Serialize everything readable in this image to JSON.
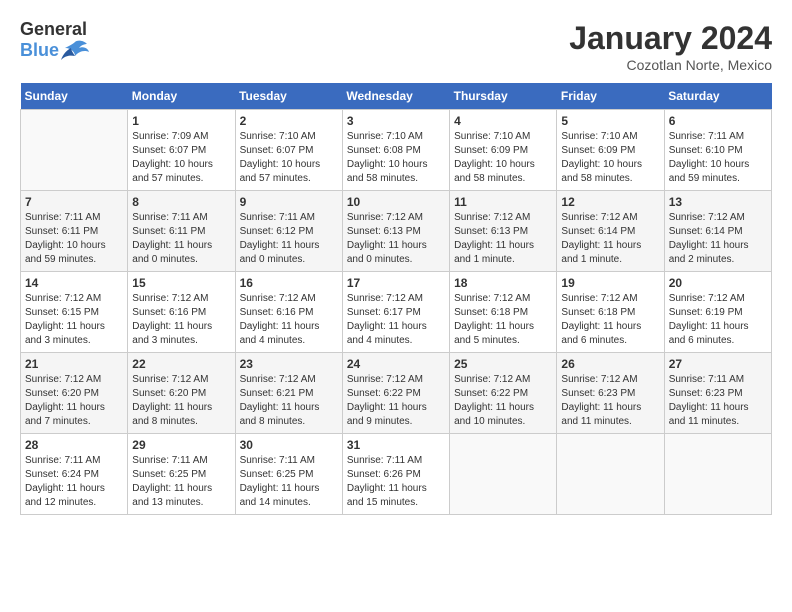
{
  "header": {
    "logo_general": "General",
    "logo_blue": "Blue",
    "month": "January 2024",
    "location": "Cozotlan Norte, Mexico"
  },
  "days_of_week": [
    "Sunday",
    "Monday",
    "Tuesday",
    "Wednesday",
    "Thursday",
    "Friday",
    "Saturday"
  ],
  "weeks": [
    [
      {
        "day": "",
        "info": ""
      },
      {
        "day": "1",
        "info": "Sunrise: 7:09 AM\nSunset: 6:07 PM\nDaylight: 10 hours\nand 57 minutes."
      },
      {
        "day": "2",
        "info": "Sunrise: 7:10 AM\nSunset: 6:07 PM\nDaylight: 10 hours\nand 57 minutes."
      },
      {
        "day": "3",
        "info": "Sunrise: 7:10 AM\nSunset: 6:08 PM\nDaylight: 10 hours\nand 58 minutes."
      },
      {
        "day": "4",
        "info": "Sunrise: 7:10 AM\nSunset: 6:09 PM\nDaylight: 10 hours\nand 58 minutes."
      },
      {
        "day": "5",
        "info": "Sunrise: 7:10 AM\nSunset: 6:09 PM\nDaylight: 10 hours\nand 58 minutes."
      },
      {
        "day": "6",
        "info": "Sunrise: 7:11 AM\nSunset: 6:10 PM\nDaylight: 10 hours\nand 59 minutes."
      }
    ],
    [
      {
        "day": "7",
        "info": "Sunrise: 7:11 AM\nSunset: 6:11 PM\nDaylight: 10 hours\nand 59 minutes."
      },
      {
        "day": "8",
        "info": "Sunrise: 7:11 AM\nSunset: 6:11 PM\nDaylight: 11 hours\nand 0 minutes."
      },
      {
        "day": "9",
        "info": "Sunrise: 7:11 AM\nSunset: 6:12 PM\nDaylight: 11 hours\nand 0 minutes."
      },
      {
        "day": "10",
        "info": "Sunrise: 7:12 AM\nSunset: 6:13 PM\nDaylight: 11 hours\nand 0 minutes."
      },
      {
        "day": "11",
        "info": "Sunrise: 7:12 AM\nSunset: 6:13 PM\nDaylight: 11 hours\nand 1 minute."
      },
      {
        "day": "12",
        "info": "Sunrise: 7:12 AM\nSunset: 6:14 PM\nDaylight: 11 hours\nand 1 minute."
      },
      {
        "day": "13",
        "info": "Sunrise: 7:12 AM\nSunset: 6:14 PM\nDaylight: 11 hours\nand 2 minutes."
      }
    ],
    [
      {
        "day": "14",
        "info": "Sunrise: 7:12 AM\nSunset: 6:15 PM\nDaylight: 11 hours\nand 3 minutes."
      },
      {
        "day": "15",
        "info": "Sunrise: 7:12 AM\nSunset: 6:16 PM\nDaylight: 11 hours\nand 3 minutes."
      },
      {
        "day": "16",
        "info": "Sunrise: 7:12 AM\nSunset: 6:16 PM\nDaylight: 11 hours\nand 4 minutes."
      },
      {
        "day": "17",
        "info": "Sunrise: 7:12 AM\nSunset: 6:17 PM\nDaylight: 11 hours\nand 4 minutes."
      },
      {
        "day": "18",
        "info": "Sunrise: 7:12 AM\nSunset: 6:18 PM\nDaylight: 11 hours\nand 5 minutes."
      },
      {
        "day": "19",
        "info": "Sunrise: 7:12 AM\nSunset: 6:18 PM\nDaylight: 11 hours\nand 6 minutes."
      },
      {
        "day": "20",
        "info": "Sunrise: 7:12 AM\nSunset: 6:19 PM\nDaylight: 11 hours\nand 6 minutes."
      }
    ],
    [
      {
        "day": "21",
        "info": "Sunrise: 7:12 AM\nSunset: 6:20 PM\nDaylight: 11 hours\nand 7 minutes."
      },
      {
        "day": "22",
        "info": "Sunrise: 7:12 AM\nSunset: 6:20 PM\nDaylight: 11 hours\nand 8 minutes."
      },
      {
        "day": "23",
        "info": "Sunrise: 7:12 AM\nSunset: 6:21 PM\nDaylight: 11 hours\nand 8 minutes."
      },
      {
        "day": "24",
        "info": "Sunrise: 7:12 AM\nSunset: 6:22 PM\nDaylight: 11 hours\nand 9 minutes."
      },
      {
        "day": "25",
        "info": "Sunrise: 7:12 AM\nSunset: 6:22 PM\nDaylight: 11 hours\nand 10 minutes."
      },
      {
        "day": "26",
        "info": "Sunrise: 7:12 AM\nSunset: 6:23 PM\nDaylight: 11 hours\nand 11 minutes."
      },
      {
        "day": "27",
        "info": "Sunrise: 7:11 AM\nSunset: 6:23 PM\nDaylight: 11 hours\nand 11 minutes."
      }
    ],
    [
      {
        "day": "28",
        "info": "Sunrise: 7:11 AM\nSunset: 6:24 PM\nDaylight: 11 hours\nand 12 minutes."
      },
      {
        "day": "29",
        "info": "Sunrise: 7:11 AM\nSunset: 6:25 PM\nDaylight: 11 hours\nand 13 minutes."
      },
      {
        "day": "30",
        "info": "Sunrise: 7:11 AM\nSunset: 6:25 PM\nDaylight: 11 hours\nand 14 minutes."
      },
      {
        "day": "31",
        "info": "Sunrise: 7:11 AM\nSunset: 6:26 PM\nDaylight: 11 hours\nand 15 minutes."
      },
      {
        "day": "",
        "info": ""
      },
      {
        "day": "",
        "info": ""
      },
      {
        "day": "",
        "info": ""
      }
    ]
  ]
}
